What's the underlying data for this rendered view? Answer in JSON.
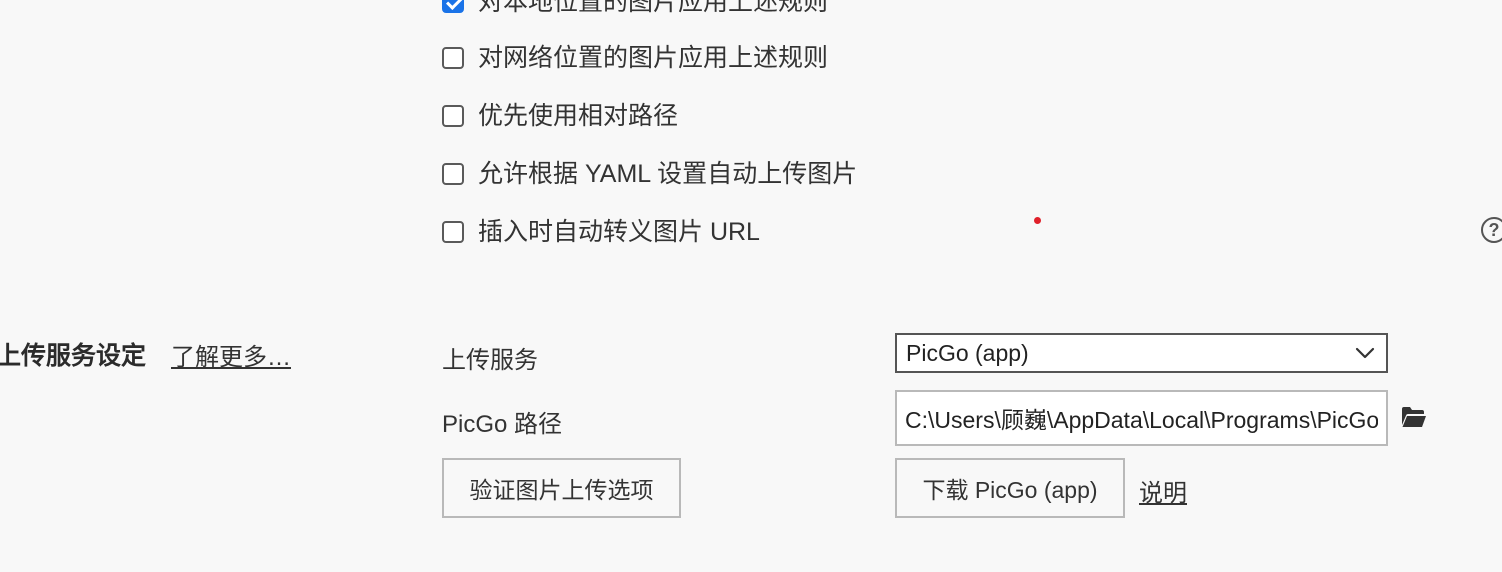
{
  "image_rules": {
    "apply_local": {
      "label": "对本地位置的图片应用上述规则",
      "checked": true
    },
    "apply_network": {
      "label": "对网络位置的图片应用上述规则",
      "checked": false
    },
    "prefer_relative": {
      "label": "优先使用相对路径",
      "checked": false
    },
    "yaml_auto_upload": {
      "label": "允许根据 YAML 设置自动上传图片",
      "checked": false
    },
    "escape_url": {
      "label": "插入时自动转义图片 URL",
      "checked": false
    }
  },
  "help_icon": {
    "name": "help-icon",
    "glyph": "?"
  },
  "upload_service": {
    "section_title": "上传服务设定",
    "learn_more": "了解更多…",
    "service_label": "上传服务",
    "service_value": "PicGo (app)",
    "path_label": "PicGo 路径",
    "path_value": "C:\\Users\\顾巍\\AppData\\Local\\Programs\\PicGo\\PicGo.exe",
    "verify_button": "验证图片上传选项",
    "download_button": "下载 PicGo (app)",
    "doc_link": "说明"
  },
  "colors": {
    "background": "#f8f8f8",
    "checkbox_checked": "#1a73e8",
    "red_dot": "#e0202a"
  }
}
